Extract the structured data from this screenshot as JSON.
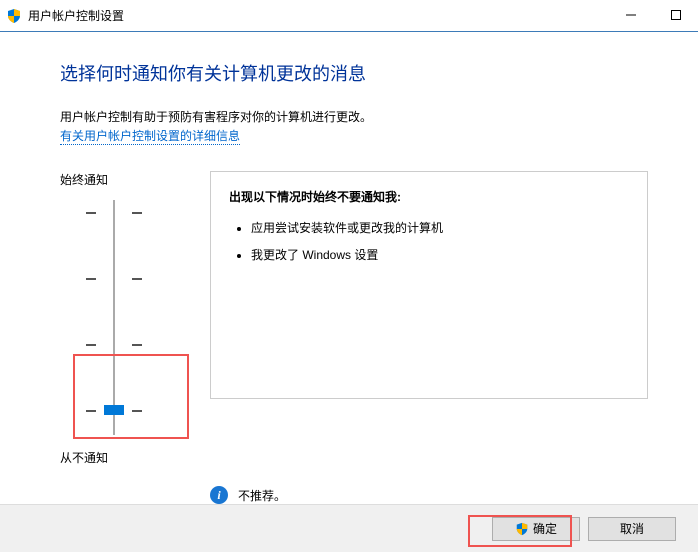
{
  "titlebar": {
    "title": "用户帐户控制设置"
  },
  "heading": "选择何时通知你有关计算机更改的消息",
  "description": "用户帐户控制有助于预防有害程序对你的计算机进行更改。",
  "link": "有关用户帐户控制设置的详细信息",
  "slider": {
    "top_label": "始终通知",
    "bottom_label": "从不通知"
  },
  "panel": {
    "title": "出现以下情况时始终不要通知我:",
    "items": [
      "应用尝试安装软件或更改我的计算机",
      "我更改了 Windows 设置"
    ]
  },
  "recommendation": {
    "text": "不推荐。"
  },
  "buttons": {
    "ok": "确定",
    "cancel": "取消"
  }
}
